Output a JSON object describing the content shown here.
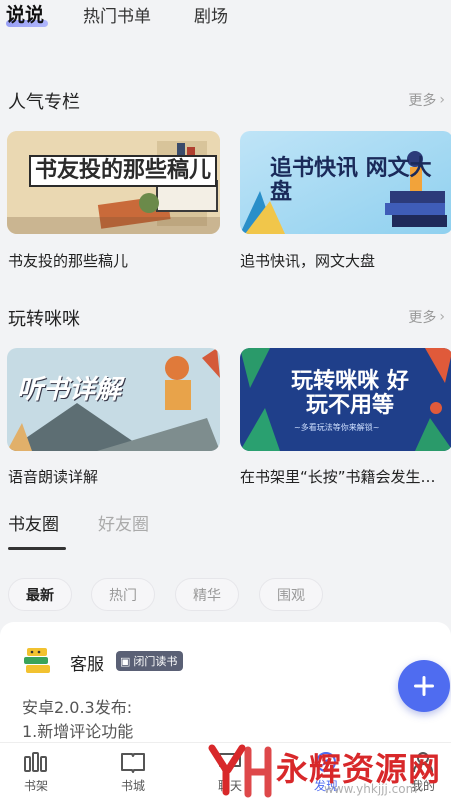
{
  "top_tabs": [
    {
      "label": "说说",
      "active": true
    },
    {
      "label": "热门书单",
      "active": false
    },
    {
      "label": "剧场",
      "active": false
    }
  ],
  "popular_column": {
    "title": "人气专栏",
    "more": "更多",
    "cards": [
      {
        "banner": "书友投的那些稿儿",
        "caption": "书友投的那些稿儿"
      },
      {
        "banner": "追书快讯 网文大盘",
        "caption": "追书快讯，网文大盘"
      }
    ]
  },
  "play_guide": {
    "title": "玩转咪咪",
    "more": "更多",
    "cards": [
      {
        "banner": "听书详解",
        "caption": "语音朗读详解"
      },
      {
        "banner": "玩转咪咪 好玩不用等",
        "subtitle": "~多看玩法等你来解锁~",
        "caption": "在书架里“长按”书籍会发生…"
      }
    ]
  },
  "circle_tabs": [
    {
      "label": "书友圈",
      "active": true
    },
    {
      "label": "好友圈",
      "active": false
    }
  ],
  "filters": [
    {
      "label": "最新",
      "active": true
    },
    {
      "label": "热门",
      "active": false
    },
    {
      "label": "精华",
      "active": false
    },
    {
      "label": "围观",
      "active": false
    }
  ],
  "post": {
    "author": "客服",
    "badge": "闭门读书",
    "lines": [
      "安卓2.0.3发布:",
      "1.新增评论功能"
    ]
  },
  "bottom_nav": [
    {
      "label": "书架",
      "icon": "bookshelf-icon"
    },
    {
      "label": "书城",
      "icon": "bookstore-icon"
    },
    {
      "label": "聊天",
      "icon": "chat-icon"
    },
    {
      "label": "发现",
      "icon": "discover-icon",
      "active": true
    },
    {
      "label": "我的",
      "icon": "profile-icon"
    }
  ],
  "watermark": {
    "text": "永辉资源网",
    "url": "www.yhkjjj.com"
  },
  "colors": {
    "accent": "#4f6cf0",
    "background": "#f2f3f5",
    "watermark": "#d8282a"
  }
}
